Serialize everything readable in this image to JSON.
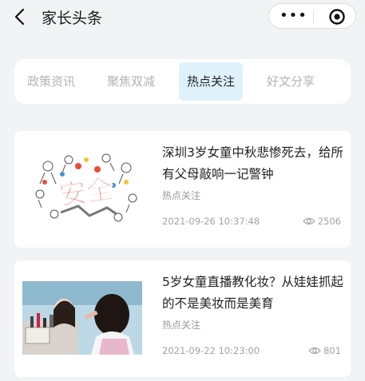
{
  "header": {
    "title": "家长头条",
    "more_icon": "more-dots-icon",
    "close_icon": "target-icon"
  },
  "tabs": [
    {
      "label": "政策资讯",
      "active": false
    },
    {
      "label": "聚焦双减",
      "active": false
    },
    {
      "label": "热点关注",
      "active": true
    },
    {
      "label": "好文分享",
      "active": false
    }
  ],
  "articles": [
    {
      "title": "深圳3岁女童中秋悲惨死去，给所有父母敲响一记警钟",
      "category": "热点关注",
      "date": "2021-09-26 10:37:48",
      "views": "2506",
      "image_text": "安全"
    },
    {
      "title": "5岁女童直播教化妆？从娃娃抓起的不是美妆而是美育",
      "category": "热点关注",
      "date": "2021-09-22 10:23:00",
      "views": "801"
    }
  ],
  "colors": {
    "active_tab_bg": "#dff1fa",
    "page_bg": "#f2f3f5"
  }
}
